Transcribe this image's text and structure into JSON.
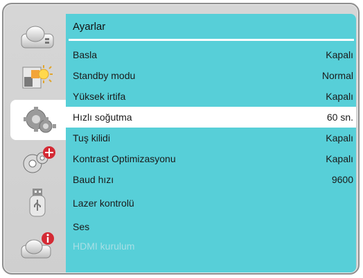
{
  "sidebar": {
    "tabs": [
      {
        "icon": "projector-icon",
        "active": false
      },
      {
        "icon": "picture-adjust-icon",
        "active": false
      },
      {
        "icon": "settings-gears-icon",
        "active": true
      },
      {
        "icon": "advanced-settings-gears-icon",
        "active": false
      },
      {
        "icon": "usb-icon",
        "active": false
      },
      {
        "icon": "projector-info-icon",
        "active": false
      }
    ]
  },
  "panel": {
    "title": "Ayarlar",
    "items": [
      {
        "label": "Basla",
        "value": "Kapalı",
        "state": "normal"
      },
      {
        "label": "Standby modu",
        "value": "Normal",
        "state": "normal"
      },
      {
        "label": "Yüksek irtifa",
        "value": "Kapalı",
        "state": "normal"
      },
      {
        "label": "Hızlı soğutma",
        "value": "60 sn.",
        "state": "selected"
      },
      {
        "label": "Tuş kilidi",
        "value": "Kapalı",
        "state": "normal"
      },
      {
        "label": "Kontrast Optimizasyonu",
        "value": "Kapalı",
        "state": "normal"
      },
      {
        "label": "Baud hızı",
        "value": "9600",
        "state": "normal"
      },
      {
        "label": "Lazer kontrolü",
        "value": "",
        "state": "normal"
      },
      {
        "label": "Ses",
        "value": "",
        "state": "normal"
      },
      {
        "label": "HDMI kurulum",
        "value": "",
        "state": "disabled"
      }
    ]
  },
  "colors": {
    "panel_background": "#57cfd8",
    "selected_row": "#ffffff",
    "disabled_text": "#a9dfe5",
    "frame_background": "#d3d3d3"
  }
}
